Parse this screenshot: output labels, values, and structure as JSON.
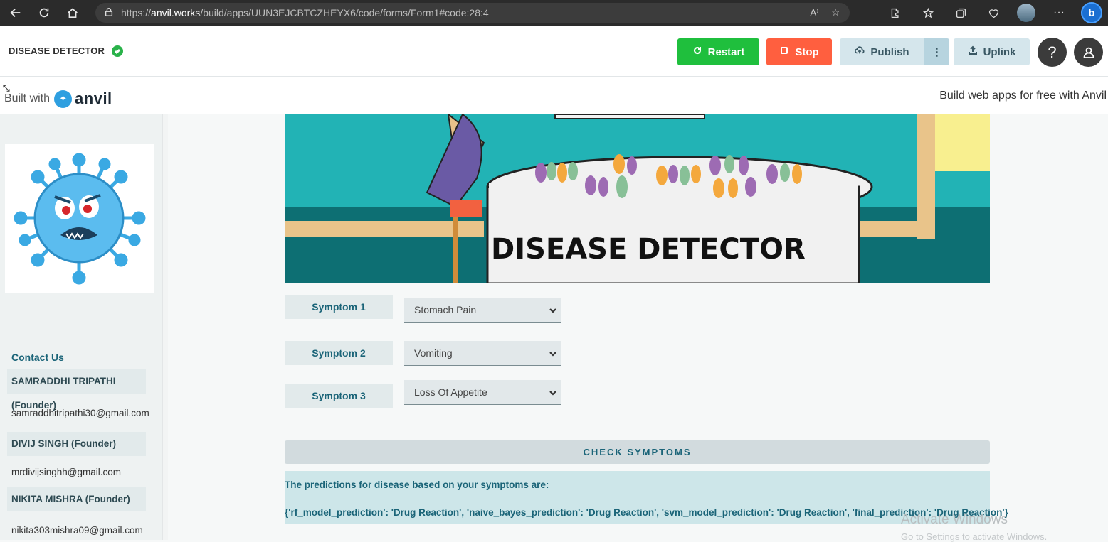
{
  "browser": {
    "url_prefix": "https://",
    "url_host": "anvil.works",
    "url_path": "/build/apps/UUN3EJCBTCZHEYX6/code/forms/Form1#code:28:4",
    "read_aloud": "A⁾"
  },
  "header": {
    "app_name": "DISEASE DETECTOR",
    "restart_label": "Restart",
    "stop_label": "Stop",
    "publish_label": "Publish",
    "publish_more": "⋮",
    "uplink_label": "Uplink",
    "help_label": "?"
  },
  "built_bar": {
    "built_with": "Built with",
    "logo_word": "anvil",
    "right_text": "Build web apps for free with Anvil"
  },
  "sidebar": {
    "contact_title": "Contact Us",
    "founders": [
      {
        "name": "SAMRADDHI TRIPATHI (Founder)",
        "email": "samraddhitripathi30@gmail.com"
      },
      {
        "name": "DIVIJ SINGH (Founder)",
        "email": "mrdivijsinghh@gmail.com"
      },
      {
        "name": "NIKITA MISHRA (Founder)",
        "email": "nikita303mishra09@gmail.com"
      }
    ]
  },
  "hero": {
    "title": "DISEASE DETECTOR"
  },
  "symptoms": [
    {
      "label": "Symptom 1",
      "value": "Stomach Pain"
    },
    {
      "label": "Symptom 2",
      "value": "Vomiting"
    },
    {
      "label": "Symptom 3",
      "value": "Loss Of Appetite"
    }
  ],
  "check_button": "CHECK SYMPTOMS",
  "result": {
    "heading": "The predictions for disease based on your symptoms are:",
    "text": "{'rf_model_prediction': 'Drug Reaction', 'naive_bayes_prediction': 'Drug Reaction', 'svm_model_prediction': 'Drug Reaction', 'final_prediction': 'Drug Reaction'}"
  },
  "watermark": {
    "line1": "Activate Windows",
    "line2": "Go to Settings to activate Windows."
  },
  "colors": {
    "restart": "#1fbf3d",
    "stop": "#ff5f3f",
    "accent_text": "#1a6478",
    "hero_bg": "#22b3b5"
  }
}
